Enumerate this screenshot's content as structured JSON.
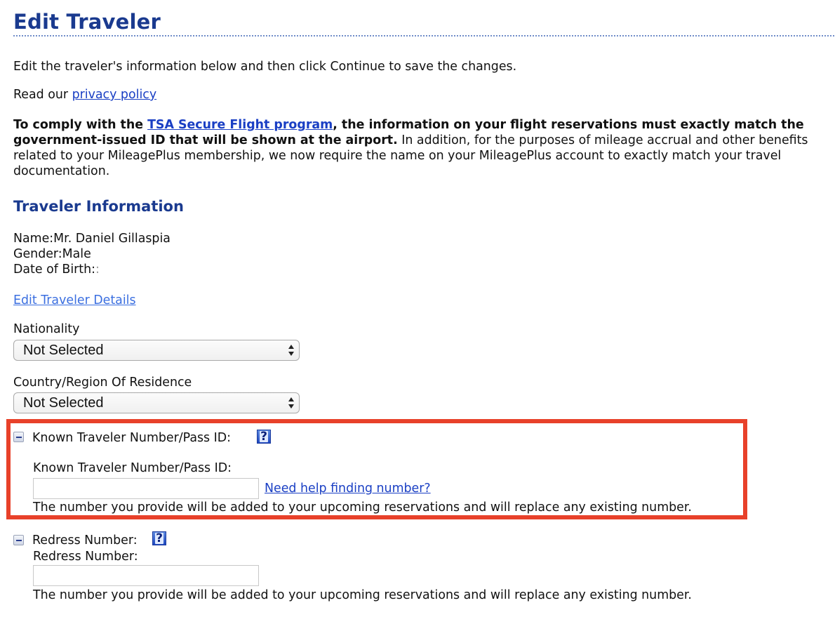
{
  "page": {
    "title": "Edit Traveler",
    "intro": "Edit the traveler's information below and then click Continue to save the changes.",
    "privacy_prefix": "Read our ",
    "privacy_link": "privacy policy",
    "compliance": {
      "bold_prefix": "To comply with the ",
      "tsa_link": "TSA Secure Flight program",
      "bold_suffix": ", the information on your flight reservations must exactly match the government-issued ID that will be shown at the airport.",
      "normal_text": " In addition, for the purposes of mileage accrual and other benefits related to your MileagePlus membership, we now require the name on your MileagePlus account to exactly match your travel documentation."
    }
  },
  "traveler_info": {
    "section_title": "Traveler Information",
    "fields": [
      {
        "label": "Name:",
        "value": "Mr. Daniel Gillaspia"
      },
      {
        "label": "Gender:",
        "value": "Male"
      },
      {
        "label": "Date of Birth:",
        "value": ":"
      }
    ],
    "edit_link": "Edit Traveler Details"
  },
  "selects": {
    "nationality": {
      "label": "Nationality",
      "selected": "Not Selected"
    },
    "residence": {
      "label": "Country/Region Of Residence",
      "selected": "Not Selected"
    }
  },
  "known_traveler": {
    "header": "Known Traveler Number/Pass ID:",
    "sublabel": "Known Traveler Number/Pass ID:",
    "input_value": "",
    "help_link": "Need help finding number?",
    "note": "The number you provide will be added to your upcoming reservations and will replace any existing number.",
    "highlight_color": "#e8412a"
  },
  "redress": {
    "header": "Redress Number:",
    "sublabel": "Redress Number:",
    "input_value": "",
    "note": "The number you provide will be added to your upcoming reservations and will replace any existing number."
  },
  "icons": {
    "collapse": "minus-toggle-icon",
    "help": "question-mark-help-icon",
    "help_glyph": "?",
    "select_arrows": "up-down-arrows-icon"
  }
}
